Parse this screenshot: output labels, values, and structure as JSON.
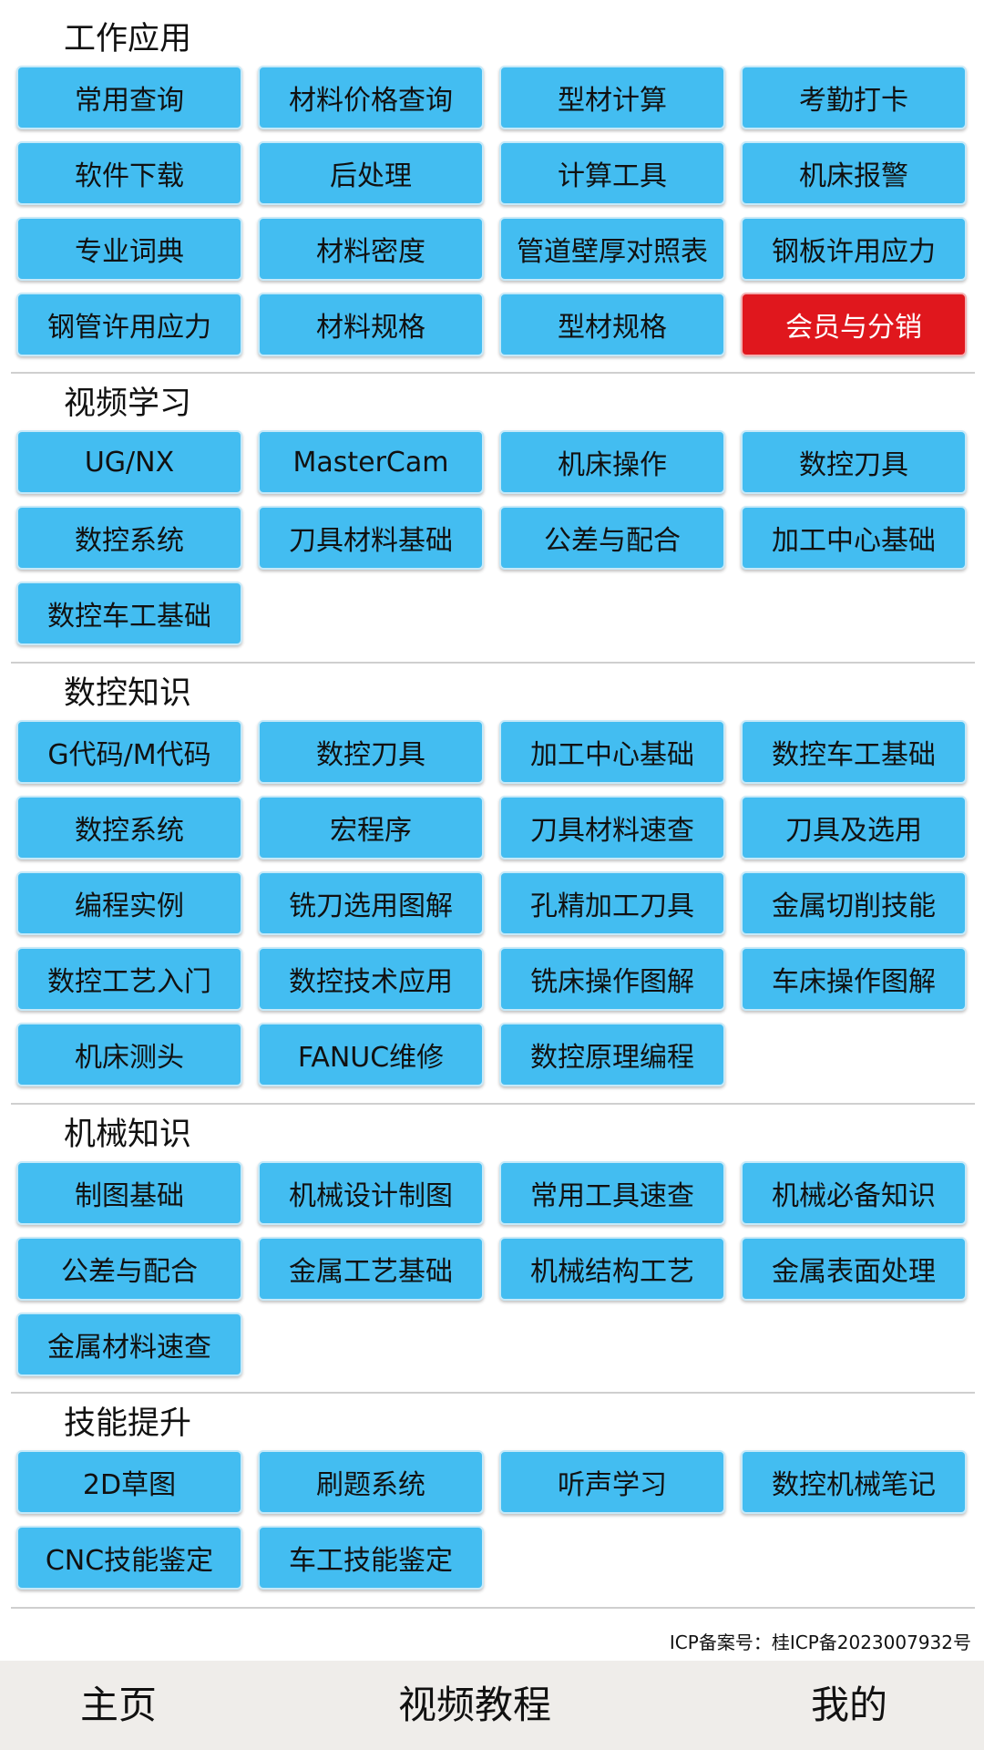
{
  "sections": [
    {
      "title": "工作应用",
      "items": [
        {
          "label": "常用查询"
        },
        {
          "label": "材料价格查询"
        },
        {
          "label": "型材计算"
        },
        {
          "label": "考勤打卡"
        },
        {
          "label": "软件下载"
        },
        {
          "label": "后处理"
        },
        {
          "label": "计算工具"
        },
        {
          "label": "机床报警"
        },
        {
          "label": "专业词典"
        },
        {
          "label": "材料密度"
        },
        {
          "label": "管道壁厚对照表"
        },
        {
          "label": "钢板许用应力"
        },
        {
          "label": "钢管许用应力"
        },
        {
          "label": "材料规格"
        },
        {
          "label": "型材规格"
        },
        {
          "label": "会员与分销",
          "highlight": true,
          "color": "#e0171d"
        }
      ]
    },
    {
      "title": "视频学习",
      "items": [
        {
          "label": "UG/NX"
        },
        {
          "label": "MasterCam"
        },
        {
          "label": "机床操作"
        },
        {
          "label": "数控刀具"
        },
        {
          "label": "数控系统"
        },
        {
          "label": "刀具材料基础"
        },
        {
          "label": "公差与配合"
        },
        {
          "label": "加工中心基础"
        },
        {
          "label": "数控车工基础"
        }
      ]
    },
    {
      "title": "数控知识",
      "items": [
        {
          "label": "G代码/M代码"
        },
        {
          "label": "数控刀具"
        },
        {
          "label": "加工中心基础"
        },
        {
          "label": "数控车工基础"
        },
        {
          "label": "数控系统"
        },
        {
          "label": "宏程序"
        },
        {
          "label": "刀具材料速查"
        },
        {
          "label": "刀具及选用"
        },
        {
          "label": "编程实例"
        },
        {
          "label": "铣刀选用图解"
        },
        {
          "label": "孔精加工刀具"
        },
        {
          "label": "金属切削技能"
        },
        {
          "label": "数控工艺入门"
        },
        {
          "label": "数控技术应用"
        },
        {
          "label": "铣床操作图解"
        },
        {
          "label": "车床操作图解"
        },
        {
          "label": "机床测头"
        },
        {
          "label": "FANUC维修"
        },
        {
          "label": "数控原理编程"
        }
      ]
    },
    {
      "title": "机械知识",
      "items": [
        {
          "label": "制图基础"
        },
        {
          "label": "机械设计制图"
        },
        {
          "label": "常用工具速查"
        },
        {
          "label": "机械必备知识"
        },
        {
          "label": "公差与配合"
        },
        {
          "label": "金属工艺基础"
        },
        {
          "label": "机械结构工艺"
        },
        {
          "label": "金属表面处理"
        },
        {
          "label": "金属材料速查"
        }
      ]
    },
    {
      "title": "技能提升",
      "items": [
        {
          "label": "2D草图"
        },
        {
          "label": "刷题系统"
        },
        {
          "label": "听声学习"
        },
        {
          "label": "数控机械笔记"
        },
        {
          "label": "CNC技能鉴定"
        },
        {
          "label": "车工技能鉴定"
        }
      ]
    }
  ],
  "footer": {
    "icp": "ICP备案号：桂ICP备2023007932号"
  },
  "bottom_nav": [
    {
      "label": "主页"
    },
    {
      "label": "视频教程"
    },
    {
      "label": "我的"
    }
  ],
  "colors": {
    "button": "#43bdf1",
    "button_highlight": "#e0171d",
    "nav_background": "#efedea"
  }
}
